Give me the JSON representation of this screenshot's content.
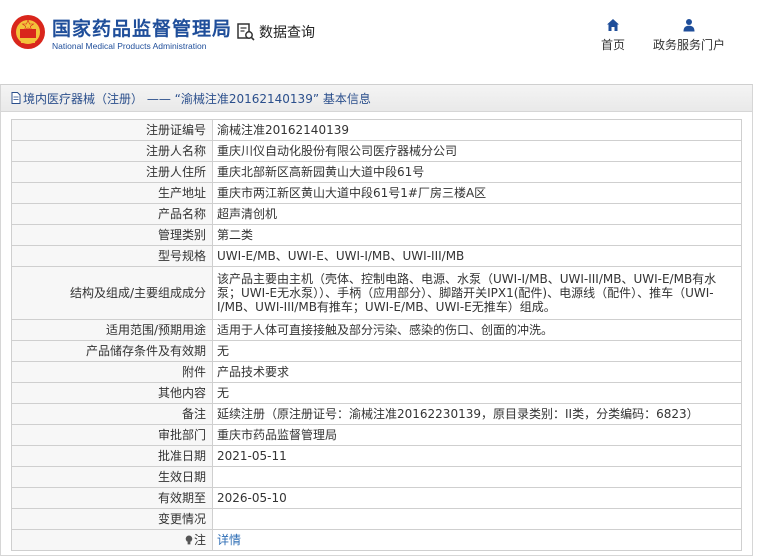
{
  "site": {
    "name_cn": "国家药品监督管理局",
    "name_en": "National Medical Products Administration",
    "query_label": "数据查询",
    "nav": [
      {
        "label": "首页"
      },
      {
        "label": "政务服务门户"
      }
    ]
  },
  "panel": {
    "title": "境内医疗器械（注册） —— “渝械注准20162140139” 基本信息"
  },
  "rows": [
    {
      "key": "注册证编号",
      "value": "渝械注准20162140139"
    },
    {
      "key": "注册人名称",
      "value": "重庆川仪自动化股份有限公司医疗器械分公司"
    },
    {
      "key": "注册人住所",
      "value": "重庆北部新区高新园黄山大道中段61号"
    },
    {
      "key": "生产地址",
      "value": "重庆市两江新区黄山大道中段61号1#厂房三楼A区"
    },
    {
      "key": "产品名称",
      "value": "超声清创机"
    },
    {
      "key": "管理类别",
      "value": "第二类"
    },
    {
      "key": "型号规格",
      "value": "UWI-E/MB、UWI-E、UWI-I/MB、UWI-III/MB"
    },
    {
      "key": "结构及组成/主要组成成分",
      "value": "该产品主要由主机（壳体、控制电路、电源、水泵（UWI-I/MB、UWI-III/MB、UWI-E/MB有水泵；UWI-E无水泵））、手柄（应用部分）、脚踏开关IPX1(配件)、电源线（配件）、推车（UWI-I/MB、UWI-III/MB有推车；UWI-E/MB、UWI-E无推车）组成。"
    },
    {
      "key": "适用范围/预期用途",
      "value": "适用于人体可直接接触及部分污染、感染的伤口、创面的冲洗。"
    },
    {
      "key": "产品储存条件及有效期",
      "value": "无"
    },
    {
      "key": "附件",
      "value": "产品技术要求"
    },
    {
      "key": "其他内容",
      "value": "无"
    },
    {
      "key": "备注",
      "value": "延续注册（原注册证号：渝械注准20162230139，原目录类别：II类，分类编码：6823）"
    },
    {
      "key": "审批部门",
      "value": "重庆市药品监督管理局"
    },
    {
      "key": "批准日期",
      "value": "2021-05-11"
    },
    {
      "key": "生效日期",
      "value": ""
    },
    {
      "key": "有效期至",
      "value": "2026-05-10"
    },
    {
      "key": "变更情况",
      "value": ""
    }
  ],
  "note_row": {
    "key": "注",
    "link": "详情"
  },
  "colors": {
    "brand": "#1f4e9a",
    "link": "#2d6db5",
    "key_bg": "#f7f7f7"
  }
}
